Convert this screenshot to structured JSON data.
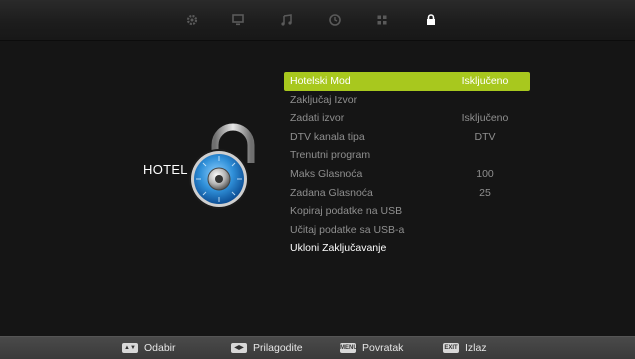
{
  "top_icons": [
    {
      "icon": "gear-icon",
      "active": false
    },
    {
      "icon": "monitor-icon",
      "active": false
    },
    {
      "icon": "music-note-icon",
      "active": false
    },
    {
      "icon": "clock-icon",
      "active": false
    },
    {
      "icon": "grid-icon",
      "active": false
    },
    {
      "icon": "lock-icon",
      "active": true
    }
  ],
  "section": {
    "title": "HOTEL"
  },
  "menu": {
    "items": [
      {
        "label": "Hotelski Mod",
        "value": "Isključeno"
      },
      {
        "label": "Zaključaj Izvor",
        "value": ""
      },
      {
        "label": "Zadati izvor",
        "value": "Isključeno"
      },
      {
        "label": "DTV kanala tipa",
        "value": "DTV"
      },
      {
        "label": "Trenutni program",
        "value": ""
      },
      {
        "label": "Maks Glasnoća",
        "value": "100"
      },
      {
        "label": "Zadana Glasnoća",
        "value": "25"
      },
      {
        "label": "Kopiraj podatke na USB",
        "value": ""
      },
      {
        "label": "Učitaj podatke sa USB-a",
        "value": ""
      },
      {
        "label": "Ukloni Zaključavanje",
        "value": ""
      }
    ],
    "selected_color": "#a8c81e"
  },
  "footer": {
    "select_label": "Odabir",
    "adjust_label": "Prilagodite",
    "menu_key": "MENU",
    "back_label": "Povratak",
    "exit_key": "EXIT",
    "exit_label": "Izlaz"
  }
}
